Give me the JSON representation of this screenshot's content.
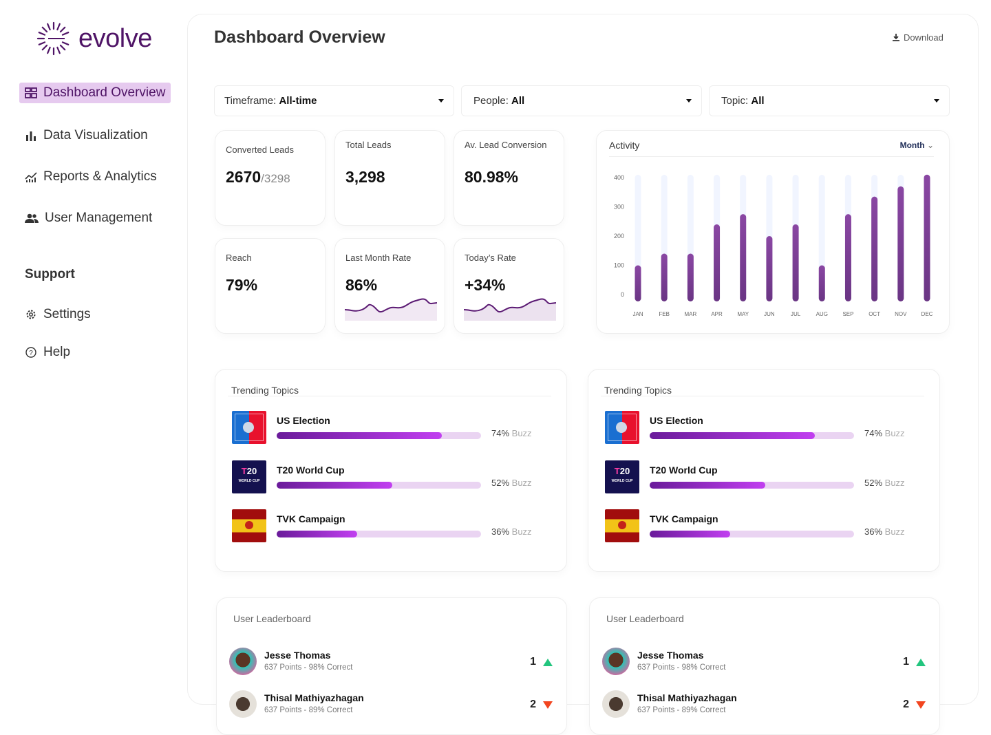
{
  "brand": {
    "name": "evolve",
    "color": "#4f1466"
  },
  "sidebar": {
    "items": [
      {
        "label": "Dashboard Overview",
        "icon": "dashboard-icon",
        "active": true
      },
      {
        "label": "Data Visualization",
        "icon": "bar-chart-icon"
      },
      {
        "label": "Reports & Analytics",
        "icon": "analytics-icon"
      },
      {
        "label": "User Management",
        "icon": "users-icon"
      }
    ],
    "support_heading": "Support",
    "support_items": [
      {
        "label": "Settings",
        "icon": "gear-icon"
      },
      {
        "label": "Help",
        "icon": "help-icon"
      }
    ]
  },
  "header": {
    "title": "Dashboard Overview",
    "download": "Download"
  },
  "filters": [
    {
      "label": "Timeframe:",
      "value": "All-time"
    },
    {
      "label": "People:",
      "value": "All"
    },
    {
      "label": "Topic:",
      "value": "All"
    }
  ],
  "stats": [
    {
      "label": "Converted Leads",
      "value": "2670",
      "suffix": "/3298"
    },
    {
      "label": "Total Leads",
      "value": "3,298"
    },
    {
      "label": "Av. Lead Conversion",
      "value": "80.98%"
    },
    {
      "label": "Reach",
      "value": "79%"
    },
    {
      "label": "Last Month Rate",
      "value": "86%"
    },
    {
      "label": "Today’s Rate",
      "value": "+34%"
    }
  ],
  "chart_data": {
    "type": "bar",
    "title": "Activity",
    "period": "Month",
    "categories": [
      "JAN",
      "FEB",
      "MAR",
      "APR",
      "MAY",
      "JUN",
      "JUL",
      "AUG",
      "SEP",
      "OCT",
      "NOV",
      "DEC"
    ],
    "values": [
      100,
      140,
      140,
      240,
      275,
      200,
      240,
      100,
      275,
      335,
      370,
      410
    ],
    "yticks": [
      "0",
      "100",
      "200",
      "300",
      "400"
    ],
    "ylim": [
      0,
      410
    ],
    "bar_color": "#7b3a94",
    "track_color": "#f1f5ff"
  },
  "trending": [
    {
      "title": "Trending Topics",
      "topics": [
        {
          "name": "US Election",
          "pct": 74,
          "pct_label": "74%",
          "buzz": "Buzz"
        },
        {
          "name": "T20 World Cup",
          "pct": 52,
          "pct_label": "52%",
          "buzz": "Buzz"
        },
        {
          "name": "TVK Campaign",
          "pct": 36,
          "pct_label": "36%",
          "buzz": "Buzz"
        }
      ]
    },
    {
      "title": "Trending Topics",
      "topics": [
        {
          "name": "US Election",
          "pct": 74,
          "pct_label": "74%",
          "buzz": "Buzz"
        },
        {
          "name": "T20 World Cup",
          "pct": 52,
          "pct_label": "52%",
          "buzz": "Buzz"
        },
        {
          "name": "TVK Campaign",
          "pct": 36,
          "pct_label": "36%",
          "buzz": "Buzz"
        }
      ]
    }
  ],
  "leaderboards": [
    {
      "title": "User Leaderboard",
      "users": [
        {
          "name": "Jesse Thomas",
          "sub": "637 Points - 98% Correct",
          "rank": "1",
          "trend": "up"
        },
        {
          "name": "Thisal Mathiyazhagan",
          "sub": "637 Points - 89% Correct",
          "rank": "2",
          "trend": "down"
        }
      ]
    },
    {
      "title": "User Leaderboard",
      "users": [
        {
          "name": "Jesse Thomas",
          "sub": "637 Points - 98% Correct",
          "rank": "1",
          "trend": "up"
        },
        {
          "name": "Thisal Mathiyazhagan",
          "sub": "637 Points - 89% Correct",
          "rank": "2",
          "trend": "down"
        }
      ]
    }
  ]
}
